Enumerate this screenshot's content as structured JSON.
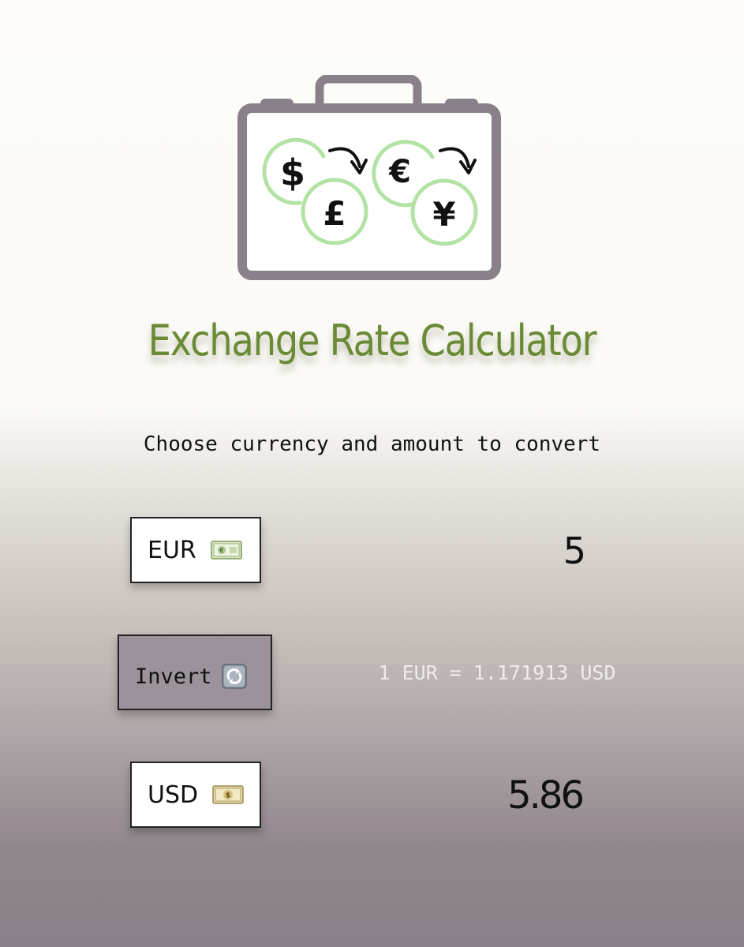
{
  "app": {
    "title": "Exchange Rate Calculator",
    "instruction": "Choose currency and amount to convert"
  },
  "logo": {
    "symbols": [
      "$",
      "£",
      "€",
      "¥"
    ]
  },
  "from": {
    "currency": "EUR",
    "icon": "euro-banknote-icon",
    "amount": "5"
  },
  "to": {
    "currency": "USD",
    "icon": "dollar-banknote-icon",
    "amount": "5.86"
  },
  "invert": {
    "label": "Invert",
    "icon": "counterclockwise-arrows-icon"
  },
  "rate": {
    "text": "1 EUR = 1.171913 USD"
  },
  "colors": {
    "title": "#6a8a36",
    "coin_ring": "#b2e3a4",
    "briefcase": "#8a8089",
    "invert_button": "#9b929b"
  }
}
